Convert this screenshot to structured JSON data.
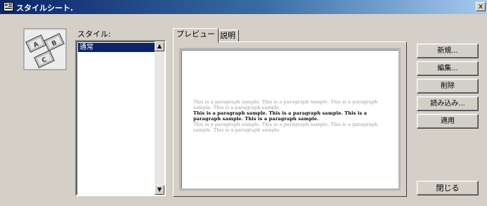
{
  "window": {
    "title": "スタイルシート.",
    "close_glyph": "x"
  },
  "dialog_icon": {
    "name": "stylesheet-app-icon"
  },
  "styles": {
    "label": "スタイル:",
    "items": [
      "通常"
    ],
    "selected_index": 0
  },
  "tabs": [
    {
      "label": "プレビュー",
      "active": true
    },
    {
      "label": "説明",
      "active": false
    }
  ],
  "preview": {
    "paragraphs": [
      {
        "text": "This is a paragraph sample. This is a paragraph sample. This is a paragraph sample. This is a paragraph sample.",
        "style": "gray"
      },
      {
        "text": "This is a paragraph sample. This is a paragraph sample. This is a paragraph sample. This is a paragraph sample.",
        "style": "bold"
      },
      {
        "text": "This is a paragraph sample. This is a paragraph sample. This is a paragraph sample. This is a paragraph sample.",
        "style": "gray"
      }
    ]
  },
  "buttons": {
    "new": "新規...",
    "edit": "編集...",
    "delete": "削除",
    "import": "読み込み...",
    "apply": "適用",
    "close": "閉じる"
  },
  "colors": {
    "titlebar_start": "#0a246a",
    "titlebar_end": "#a6caf0",
    "dialog_bg": "#d4d0c8",
    "selection": "#0a246a"
  }
}
